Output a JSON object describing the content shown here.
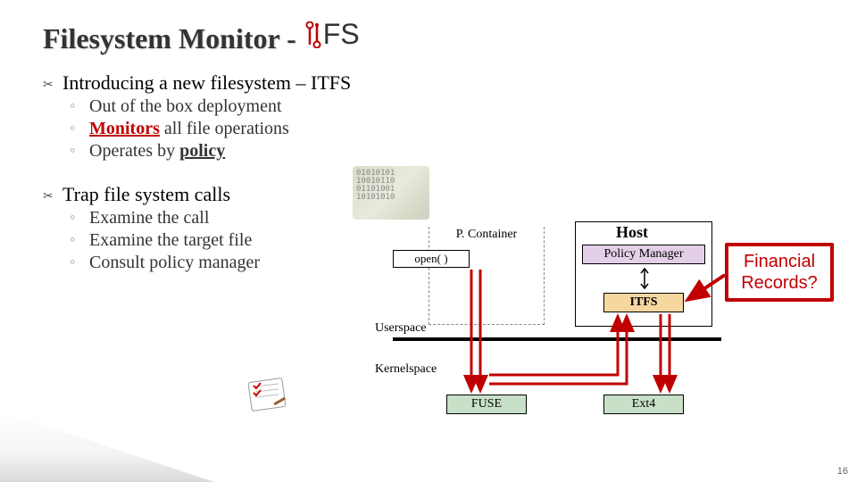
{
  "title_main": "Filesystem Monitor - ",
  "title_suffix": "FS",
  "bullets": {
    "b1": "Introducing a new filesystem – ITFS",
    "b1_subs": {
      "s1": "Out of the box deployment",
      "s2a": "Monitors",
      "s2b": " all file operations",
      "s3a": "Operates by ",
      "s3b": "policy"
    },
    "b2": "Trap file system calls",
    "b2_subs": {
      "s1": "Examine the call",
      "s2": "Examine the target file",
      "s3": "Consult policy manager"
    }
  },
  "diagram": {
    "pcontainer": "P. Container",
    "open": "open( )",
    "host": "Host",
    "pm": "Policy Manager",
    "itfs": "ITFS",
    "userspace": "Userspace",
    "kernelspace": "Kernelspace",
    "fuse": "FUSE",
    "ext4": "Ext4",
    "callout": "Financial Records?"
  },
  "binary_sample": "01010101\n10010110\n01101001\n10101010",
  "page": "16"
}
